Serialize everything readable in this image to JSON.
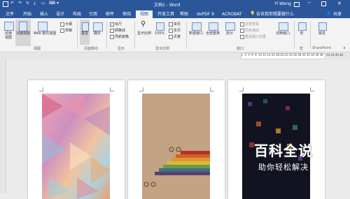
{
  "title": {
    "doc_title": "文档1 - Word",
    "user": "Yi Wang",
    "qat": [
      "↶",
      "↷",
      "↻",
      "⤓",
      "▭",
      "⌨",
      "▾"
    ]
  },
  "tabs": [
    "文件",
    "开始",
    "插入",
    "设计",
    "布局",
    "引用",
    "邮件",
    "审阅",
    "视图",
    "开发工具",
    "帮助",
    "doPDF 9",
    "ACROBAT"
  ],
  "active_tab": "视图",
  "tellme": "告诉我你想要做什么",
  "share": "共享",
  "ribbon": {
    "views": {
      "read": "阅读\n视图",
      "print": "页面视图",
      "web": "Web 版式视图",
      "outline": "大纲",
      "draft": "草稿",
      "label": "视图"
    },
    "page_move": {
      "vertical": "垂直",
      "side": "翻页",
      "label": "页面移动"
    },
    "show": {
      "ruler": "标尺",
      "gridlines": "网格线",
      "nav": "导航窗格",
      "label": "显示"
    },
    "zoom": {
      "zoom": "显示比例",
      "pct": "100%",
      "one": "单页",
      "multi": "多页",
      "width": "页宽",
      "label": "显示比例"
    },
    "window": {
      "new": "新建窗口",
      "arrange": "全部重排",
      "split": "拆分",
      "side": "并排查看",
      "sync": "同步滚动",
      "reset": "重设窗口位置",
      "switch": "切换窗口",
      "label": "窗口"
    },
    "macros": {
      "name": "宏",
      "label": "宏"
    },
    "sharepoint": {
      "name": "属性",
      "label": "SharePoint"
    }
  },
  "ruler": "L  2  4  6  8  10 12 14 16 18 20 22 24 26 28 30 32 34 36 38    42 44 46 48",
  "watermark": {
    "title": "百科全说",
    "subtitle": "助你轻松解决"
  }
}
